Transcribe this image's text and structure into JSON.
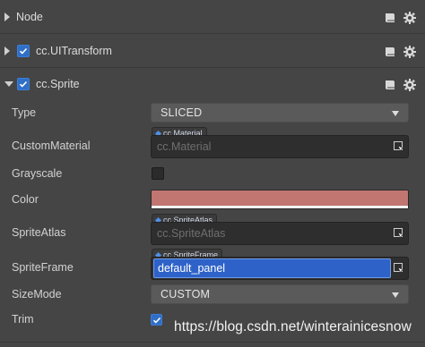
{
  "sections": {
    "node": {
      "title": "Node"
    },
    "uitransform": {
      "title": "cc.UITransform"
    },
    "sprite": {
      "title": "cc.Sprite"
    }
  },
  "properties": {
    "type": {
      "label": "Type",
      "value": "SLICED"
    },
    "custom_material": {
      "label": "CustomMaterial",
      "tag": "cc.Material",
      "placeholder": "cc.Material"
    },
    "grayscale": {
      "label": "Grayscale",
      "checked": false
    },
    "color": {
      "label": "Color",
      "swatch": "#c17672"
    },
    "sprite_atlas": {
      "label": "SpriteAtlas",
      "tag": "cc.SpriteAtlas",
      "placeholder": "cc.SpriteAtlas"
    },
    "sprite_frame": {
      "label": "SpriteFrame",
      "tag": "cc.SpriteFrame",
      "value": "default_panel"
    },
    "size_mode": {
      "label": "SizeMode",
      "value": "CUSTOM"
    },
    "trim": {
      "label": "Trim",
      "checked": true
    }
  },
  "icons": {
    "expand": "caret-right-icon",
    "collapse": "caret-down-icon",
    "help": "book-icon",
    "settings": "gear-icon",
    "pick": "asset-picker-icon",
    "check": "check-icon"
  },
  "colors": {
    "accent": "#2f6fc7",
    "selection": "#2e62c9",
    "background": "#454545"
  },
  "watermark": "https://blog.csdn.net/winterainicesnow"
}
